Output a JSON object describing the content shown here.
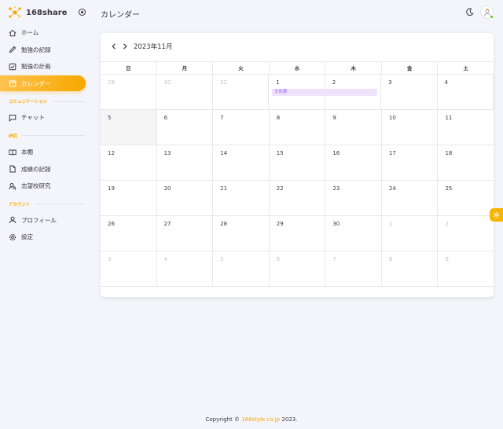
{
  "brand": {
    "name": "168share"
  },
  "header": {
    "title": "カレンダー"
  },
  "nav": {
    "items": [
      {
        "label": "ホーム",
        "icon": "home-icon"
      },
      {
        "label": "勉強の記録",
        "icon": "pencil-icon"
      },
      {
        "label": "勉強の計画",
        "icon": "checkbox-icon"
      },
      {
        "label": "カレンダー",
        "icon": "calendar-icon",
        "active": true
      }
    ],
    "section_communication": "コミュニケーション",
    "chat": {
      "label": "チャット",
      "icon": "chat-icon"
    },
    "section_study": "研究",
    "study_items": [
      {
        "label": "本棚",
        "icon": "book-icon"
      },
      {
        "label": "成績の記録",
        "icon": "file-icon"
      },
      {
        "label": "志望校研究",
        "icon": "search-user-icon"
      }
    ],
    "section_account": "アカウント",
    "account_items": [
      {
        "label": "プロフィール",
        "icon": "user-icon"
      },
      {
        "label": "設定",
        "icon": "gear-icon"
      }
    ]
  },
  "calendar": {
    "month_title": "2023年11月",
    "weekdays": [
      "日",
      "月",
      "火",
      "水",
      "木",
      "金",
      "土"
    ],
    "weeks": [
      [
        "29",
        "30",
        "31",
        "1",
        "2",
        "3",
        "4"
      ],
      [
        "5",
        "6",
        "7",
        "8",
        "9",
        "10",
        "11"
      ],
      [
        "12",
        "13",
        "14",
        "15",
        "16",
        "17",
        "18"
      ],
      [
        "19",
        "20",
        "21",
        "22",
        "23",
        "24",
        "25"
      ],
      [
        "26",
        "27",
        "28",
        "29",
        "30",
        "1",
        "2"
      ],
      [
        "3",
        "4",
        "5",
        "6",
        "7",
        "8",
        "9"
      ]
    ],
    "event": {
      "label": "文化祭"
    }
  },
  "colors": {
    "accent": "#f6a800",
    "event_bg": "#efe3fb",
    "event_text": "#9155fd"
  },
  "footer": {
    "prefix": "Copyright ©",
    "link": "168style.co.jp",
    "suffix": "2023."
  }
}
